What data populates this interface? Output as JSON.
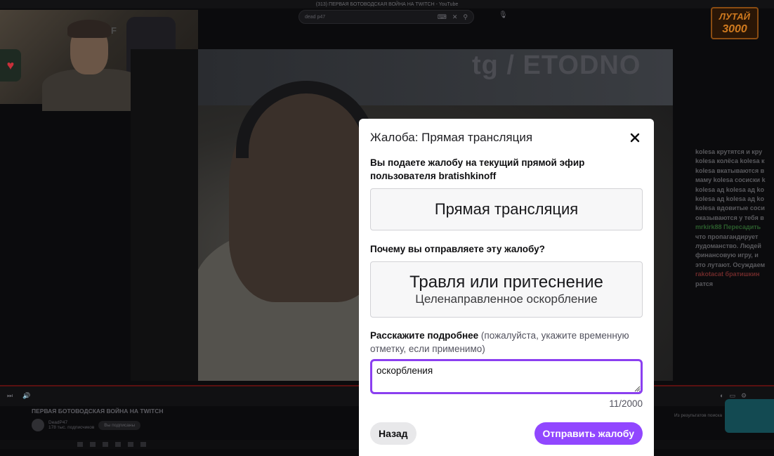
{
  "background": {
    "window_title": "(313) ПЕРВАЯ БОТОВОДСКАЯ ВОЙНА НА TWITCH - YouTube",
    "search_value": "dead p47",
    "promo_line1": "ЛУТАЙ",
    "promo_line2": "3000",
    "watermark": "tg / ETODNO",
    "video_title": "ПЕРВАЯ БОТОВОДСКАЯ ВОЙНА НА TWITCH",
    "channel_name": "DeadP47",
    "channel_subs": "178 тыс. подписчиков",
    "subscribed_label": "Вы подписаны",
    "recommend_label": "Из результатов поиска",
    "chat_lines": [
      "kolesa крутятся и кру",
      "kolesa колёса kolesa к",
      "kolesa вкатываются в",
      "маму kolesa сосиски k",
      "kolesa ад kolesa ад ko",
      "kolesa ад kolesa ад ko",
      "kolesa вдовитые соси",
      "оказываются у тебя в",
      "mrkirk88 Пересадить",
      "что пропагандирует",
      "лудоманство. Людей",
      "финансовую игру, и",
      "это лутают. Осуждаем",
      "rakotacat братишкин",
      "ратся"
    ]
  },
  "modal": {
    "title": "Жалоба: Прямая трансляция",
    "intro": "Вы подаете жалобу на текущий прямой эфир пользователя bratishkinoff",
    "target_label": "Прямая трансляция",
    "why_label": "Почему вы отправляете эту жалобу?",
    "reason_main": "Травля или притеснение",
    "reason_sub": "Целенаправленное оскорбление",
    "details_label": "Расскажите подробнее",
    "details_hint": " (пожалуйста, укажите временную отметку, если применимо)",
    "details_value": "оскорбления",
    "counter": "11/2000",
    "back_label": "Назад",
    "submit_label": "Отправить жалобу",
    "accent_color": "#9147ff"
  }
}
